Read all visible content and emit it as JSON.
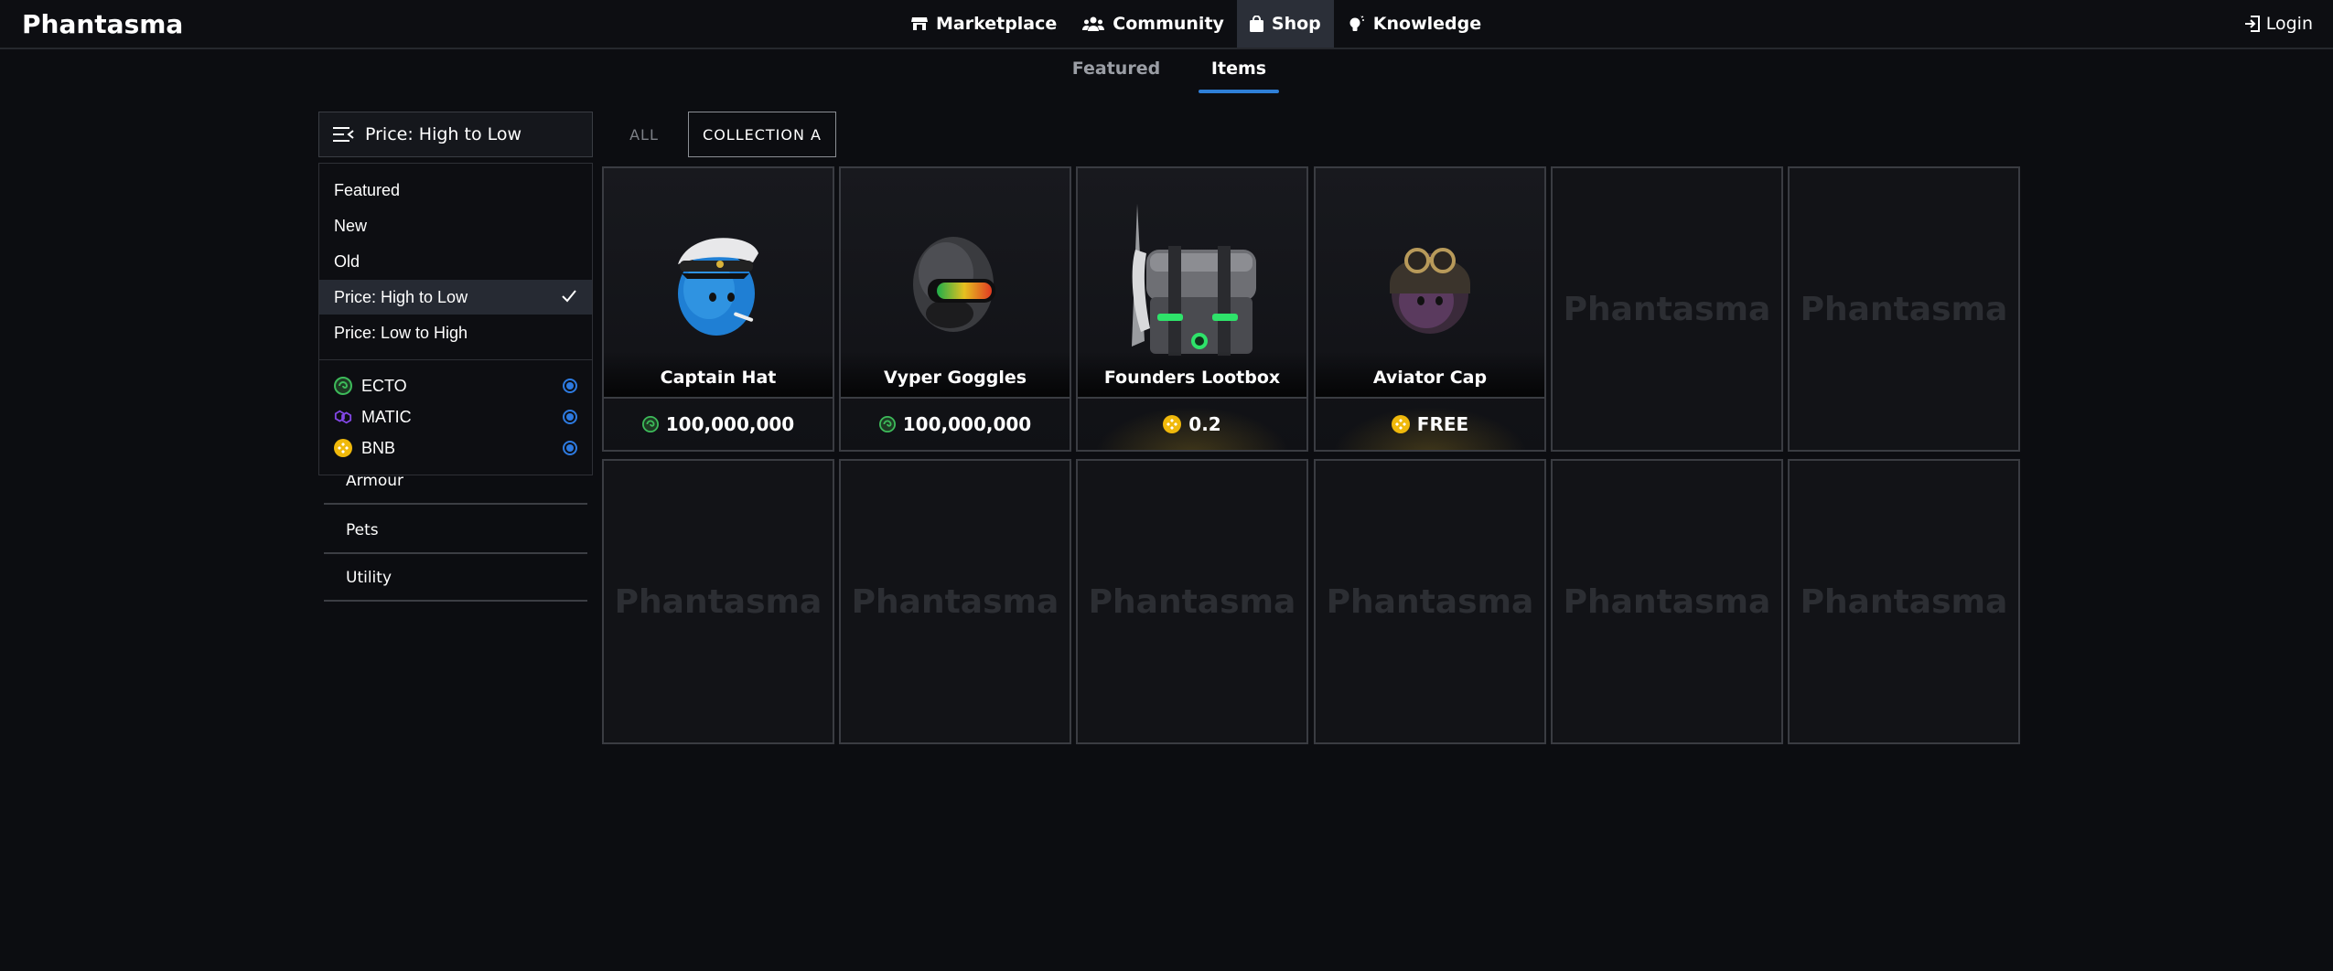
{
  "brand": {
    "logo_text": "Phantasma"
  },
  "nav": {
    "items": [
      {
        "label": "Marketplace",
        "icon": "store-icon"
      },
      {
        "label": "Community",
        "icon": "users-icon"
      },
      {
        "label": "Shop",
        "icon": "shopping-bag-icon",
        "active": true
      },
      {
        "label": "Knowledge",
        "icon": "lightbulb-icon"
      }
    ],
    "login_label": "Login"
  },
  "subtabs": {
    "featured": "Featured",
    "items": "Items",
    "active": "Items"
  },
  "sort": {
    "current": "Price: High to Low"
  },
  "filters": {
    "all": "ALL",
    "collection": "COLLECTION A"
  },
  "sort_menu": {
    "options": [
      "Featured",
      "New",
      "Old",
      "Price: High to Low",
      "Price: Low to High"
    ],
    "selected": "Price: High to Low",
    "currencies": [
      {
        "label": "ECTO",
        "color": "#3dbb5a",
        "checked": true
      },
      {
        "label": "MATIC",
        "color": "#8247e5",
        "checked": true
      },
      {
        "label": "BNB",
        "color": "#f0b90b",
        "checked": true
      }
    ]
  },
  "categories": [
    "Armour",
    "Pets",
    "Utility"
  ],
  "items": [
    {
      "name": "Captain Hat",
      "price": "100,000,000",
      "currency": "ECTO"
    },
    {
      "name": "Vyper Goggles",
      "price": "100,000,000",
      "currency": "ECTO"
    },
    {
      "name": "Founders Lootbox",
      "price": "0.2",
      "currency": "BNB"
    },
    {
      "name": "Aviator Cap",
      "price": "FREE",
      "currency": "BNB"
    }
  ],
  "placeholder_text": "Phantasma",
  "colors": {
    "accent": "#2f7fd8",
    "background": "#0c0d11",
    "ecto": "#3dbb5a",
    "bnb": "#f0b90b"
  }
}
